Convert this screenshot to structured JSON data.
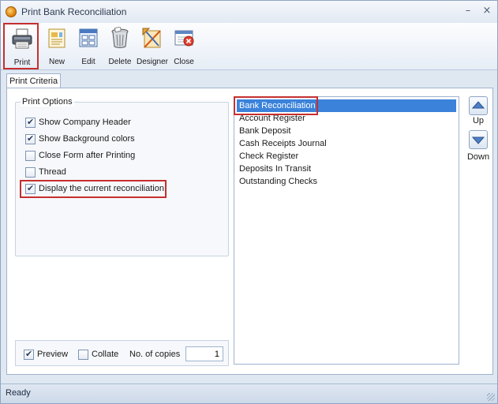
{
  "window": {
    "title": "Print Bank Reconciliation"
  },
  "titlebar": {
    "minimize_glyph": "–",
    "close_glyph": "×"
  },
  "toolbar": {
    "buttons": [
      {
        "label": "Print",
        "icon": "printer-icon"
      },
      {
        "label": "New",
        "icon": "new-document-icon"
      },
      {
        "label": "Edit",
        "icon": "edit-icon"
      },
      {
        "label": "Delete",
        "icon": "trash-icon"
      },
      {
        "label": "Designer",
        "icon": "designer-icon"
      },
      {
        "label": "Close",
        "icon": "close-window-icon"
      }
    ]
  },
  "tabs": [
    {
      "label": "Print Criteria"
    }
  ],
  "print_options": {
    "legend": "Print Options",
    "options": [
      {
        "label": "Show Company Header",
        "checked": true
      },
      {
        "label": "Show Background colors",
        "checked": true
      },
      {
        "label": "Close Form after Printing",
        "checked": false
      },
      {
        "label": "Thread",
        "checked": false
      },
      {
        "label": "Display the current reconciliation",
        "checked": true
      }
    ]
  },
  "bottom_options": {
    "preview": {
      "label": "Preview",
      "checked": true
    },
    "collate": {
      "label": "Collate",
      "checked": false
    },
    "copies_label": "No. of copies",
    "copies_value": "1"
  },
  "reports": {
    "items": [
      "Bank Reconciliation",
      "Account Register",
      "Bank Deposit",
      "Cash Receipts Journal",
      "Check Register",
      "Deposits In Transit",
      "Outstanding Checks"
    ],
    "selected_index": 0
  },
  "ordering": {
    "up_label": "Up",
    "down_label": "Down"
  },
  "status": {
    "text": "Ready"
  },
  "colors": {
    "accent": "#3a82da",
    "highlight": "#c62f2f"
  }
}
